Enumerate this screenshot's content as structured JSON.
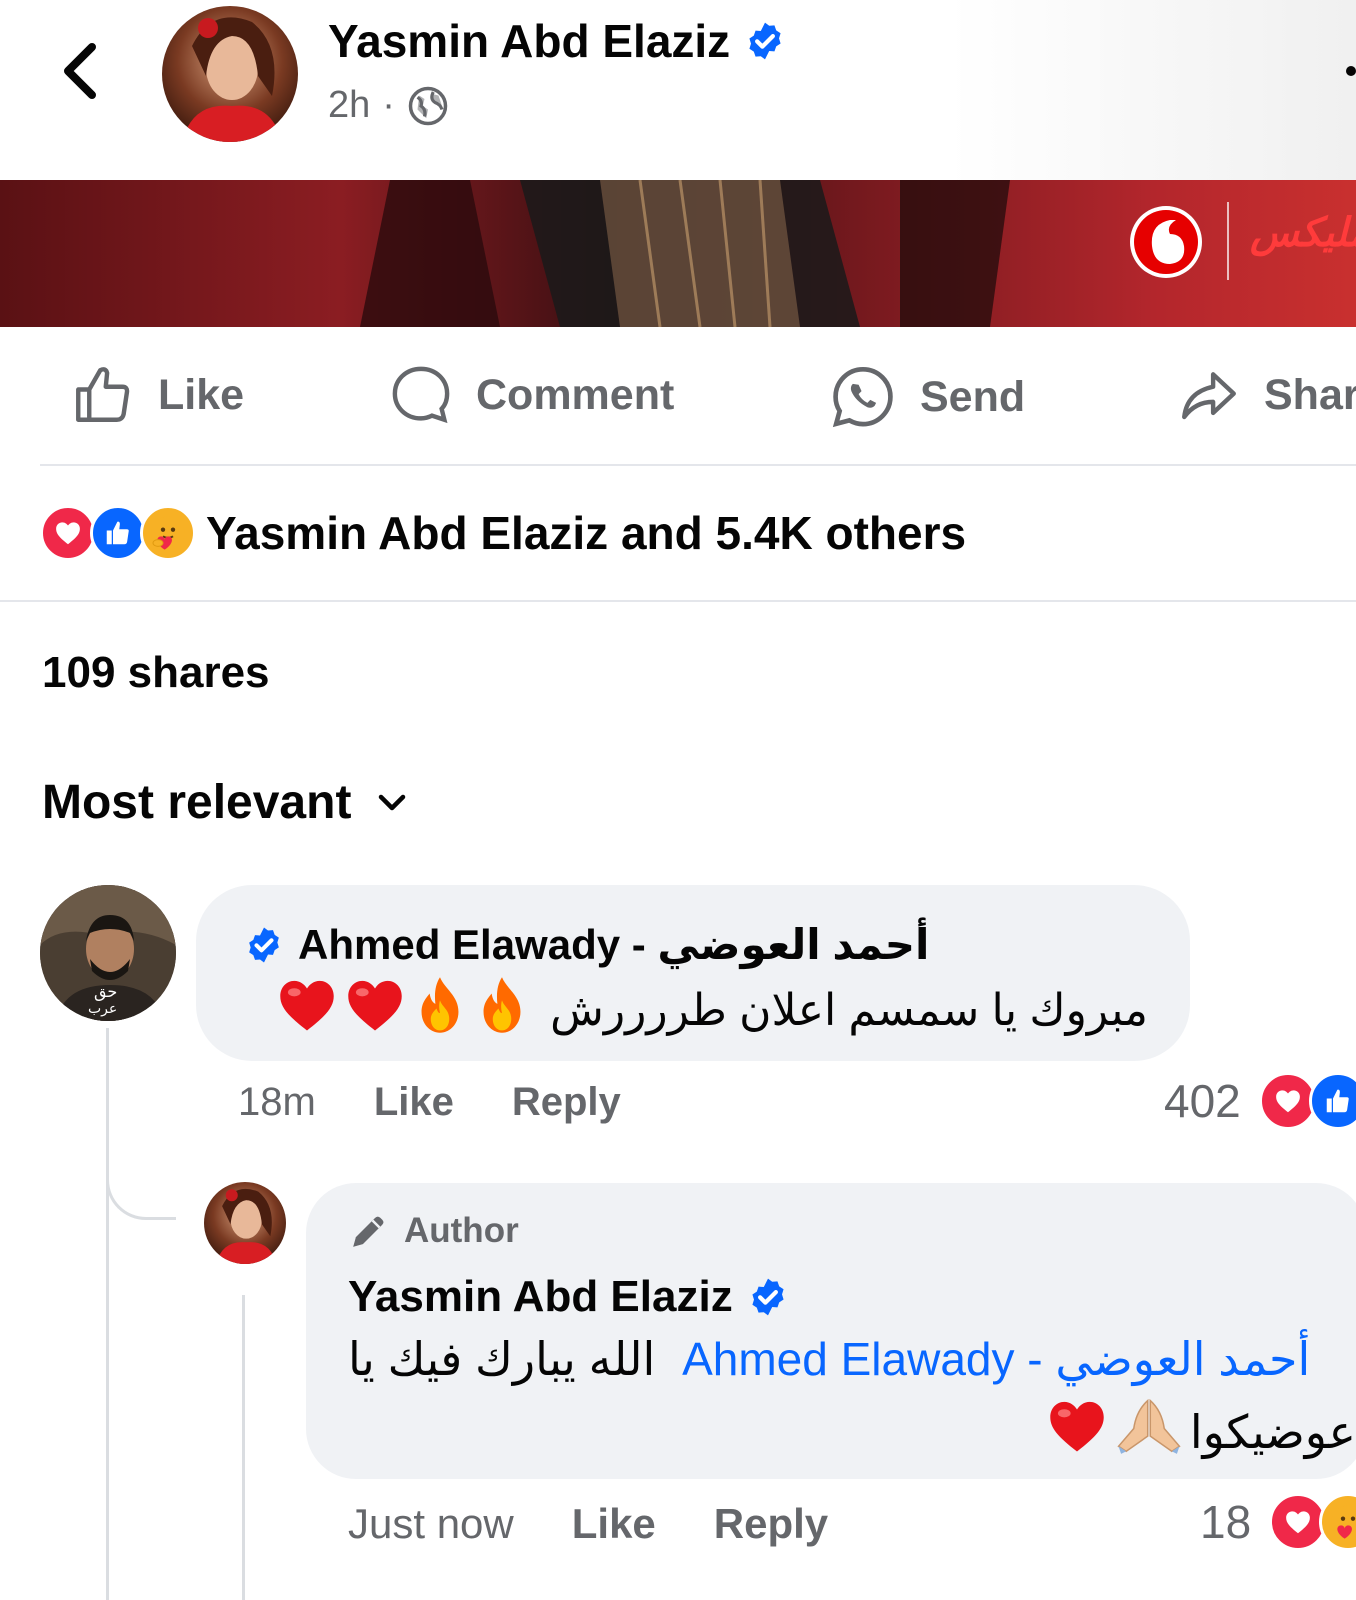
{
  "post": {
    "author_name": "Yasmin Abd Elaziz",
    "time": "2h",
    "separator": "·"
  },
  "banner": {
    "brand_text": "مليكس"
  },
  "actions": {
    "like": "Like",
    "comment": "Comment",
    "send": "Send",
    "share": "Shar"
  },
  "reactions": {
    "summary": "Yasmin Abd Elaziz and 5.4K others"
  },
  "shares": "109 shares",
  "sort": {
    "label": "Most relevant"
  },
  "comments": [
    {
      "author": "Ahmed Elawady - أحمد العوضي",
      "text": "مبروك يا سمسم اعلان طررررش",
      "time": "18m",
      "like": "Like",
      "reply": "Reply",
      "count": "402"
    },
    {
      "badge": "Author",
      "author": "Yasmin Abd Elaziz",
      "text_plain": "الله يبارك فيك يا",
      "mention": "Ahmed Elawady - أحمد العوضي",
      "text_cont": "عوضيكوا",
      "time": "Just now",
      "like": "Like",
      "reply": "Reply",
      "count": "18"
    }
  ],
  "colors": {
    "brand_blue": "#0866ff",
    "heart_red": "#f02849",
    "muted": "#65676b"
  },
  "icons": [
    "back-icon",
    "verified-icon",
    "globe-icon",
    "like-icon",
    "comment-icon",
    "whatsapp-icon",
    "share-icon",
    "chevron-down-icon",
    "pencil-icon",
    "heart-emoji",
    "fire-emoji",
    "pray-emoji"
  ]
}
